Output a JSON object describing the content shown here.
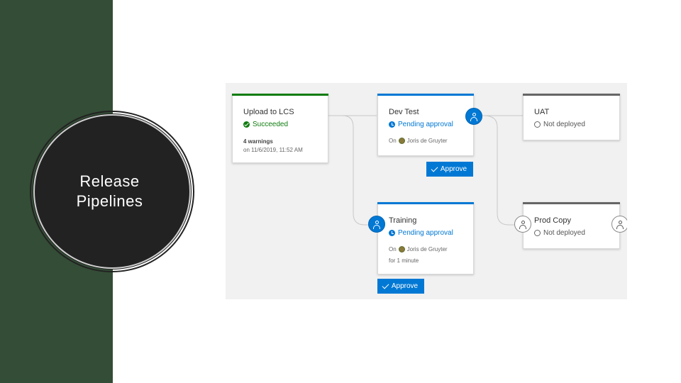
{
  "slide": {
    "title": "Release Pipelines"
  },
  "pipeline": {
    "stages": {
      "upload": {
        "name": "Upload to LCS",
        "status": "Succeeded",
        "warnings": "4 warnings",
        "timestamp": "on 11/6/2019, 11:52 AM"
      },
      "dev_test": {
        "name": "Dev Test",
        "status": "Pending approval",
        "on_prefix": "On",
        "user": "Joris de Gruyter"
      },
      "uat": {
        "name": "UAT",
        "status": "Not deployed"
      },
      "training": {
        "name": "Training",
        "status": "Pending approval",
        "on_prefix": "On",
        "user": "Joris de Gruyter",
        "duration": "for 1 minute"
      },
      "prod_copy": {
        "name": "Prod Copy",
        "status": "Not deployed"
      }
    },
    "approve_label": "Approve"
  },
  "colors": {
    "left_bar": "#344d36",
    "circle": "#222222",
    "succeeded": "#107c10",
    "pending": "#0078d4",
    "not_deployed_bar": "#666666",
    "canvas": "#f1f1f1"
  },
  "icons": {
    "succeeded": "check-circle-icon",
    "pending": "clock-icon",
    "not_deployed": "empty-circle-icon",
    "approver": "person-icon",
    "approve": "checkmark-icon",
    "user_avatar": "avatar"
  }
}
